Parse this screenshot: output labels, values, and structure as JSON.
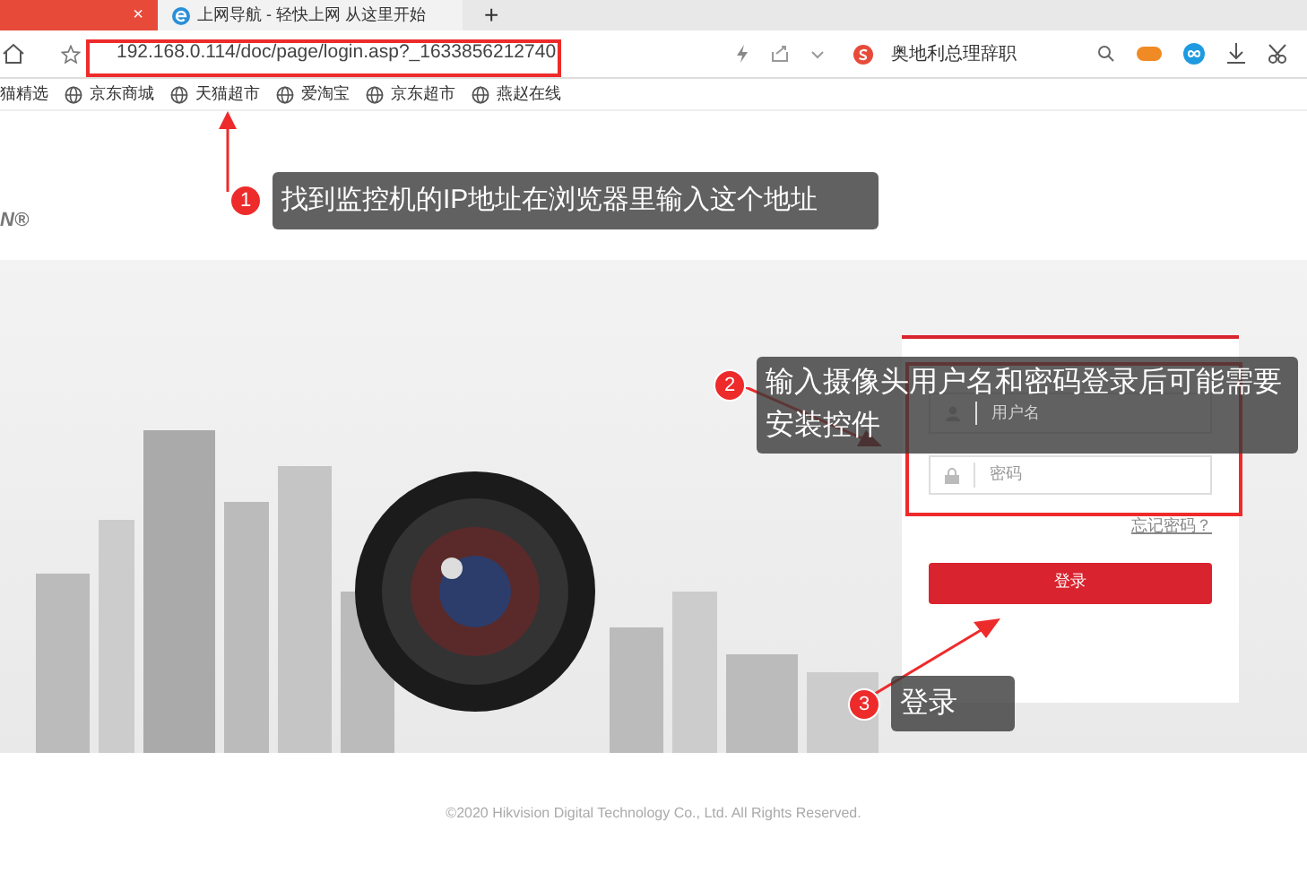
{
  "browser": {
    "tabs": [
      {
        "selected": true,
        "close": "×"
      },
      {
        "selected": false,
        "title": "上网导航 - 轻快上网 从这里开始"
      }
    ],
    "new_tab": "+",
    "address": "192.168.0.114/doc/page/login.asp?_1633856212740",
    "search_hint": "奥地利总理辞职",
    "bookmarks": [
      "猫精选",
      "京东商城",
      "天猫超市",
      "爱淘宝",
      "京东超市",
      "燕赵在线"
    ]
  },
  "page": {
    "logo_fragment": "N®",
    "login": {
      "username_placeholder": "用户名",
      "password_placeholder": "密码",
      "forgot_link": "忘记密码？",
      "submit": "登录"
    },
    "footer": "©2020 Hikvision Digital Technology Co., Ltd. All Rights Reserved."
  },
  "annotations": [
    {
      "number": "1",
      "text": "找到监控机的IP地址在浏览器里输入这个地址"
    },
    {
      "number": "2",
      "text": "输入摄像头用户名和密码登录后可能需要安装控件"
    },
    {
      "number": "3",
      "text": "登录"
    }
  ]
}
